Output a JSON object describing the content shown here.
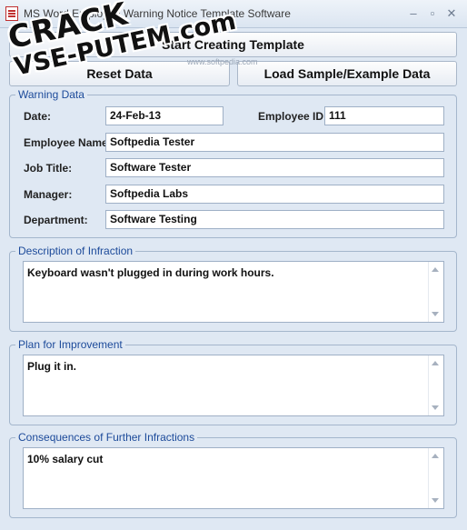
{
  "window": {
    "title": "MS Word Employee Warning Notice Template Software"
  },
  "buttons": {
    "start": "Start Creating Template",
    "reset": "Reset Data",
    "load_sample": "Load Sample/Example Data"
  },
  "groups": {
    "warning_data": "Warning Data",
    "description": "Description of Infraction",
    "plan": "Plan for Improvement",
    "consequences": "Consequences of Further Infractions"
  },
  "fields": {
    "date_label": "Date:",
    "date_value": "24-Feb-13",
    "employee_id_label": "Employee ID:",
    "employee_id_value": "111",
    "employee_name_label": "Employee Name:",
    "employee_name_value": "Softpedia Tester",
    "job_title_label": "Job Title:",
    "job_title_value": "Software Tester",
    "manager_label": "Manager:",
    "manager_value": "Softpedia Labs",
    "department_label": "Department:",
    "department_value": "Software Testing"
  },
  "texts": {
    "description": "Keyboard wasn't plugged in during work hours.",
    "plan": "Plug it in.",
    "consequences": "10% salary cut"
  },
  "watermark": {
    "line1": "CRACK",
    "line2": "VSE-PUTEM.com",
    "site": "www.softpedia.com"
  }
}
